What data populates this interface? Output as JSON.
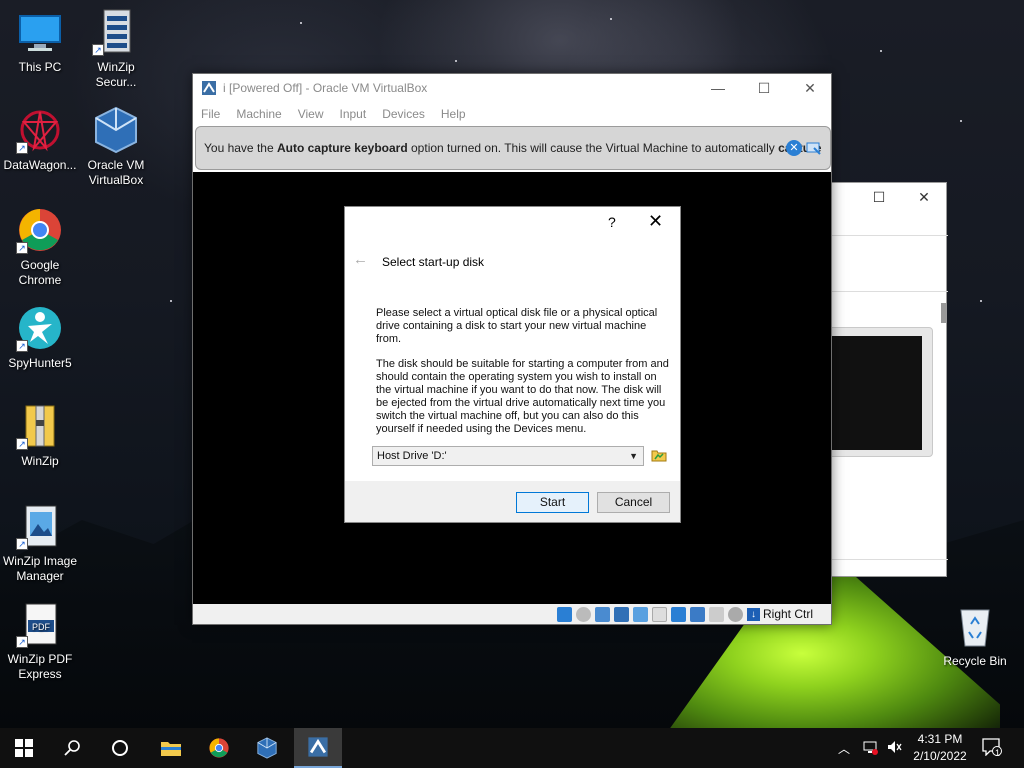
{
  "desktop": {
    "icons": [
      {
        "label": "This PC",
        "icon": "monitor-icon"
      },
      {
        "label": "WinZip Secur...",
        "icon": "winzip-secure-icon"
      },
      {
        "label": "DataWagon...",
        "icon": "datawagon-icon"
      },
      {
        "label": "Oracle VM VirtualBox",
        "icon": "virtualbox-icon"
      },
      {
        "label": "Google Chrome",
        "icon": "chrome-icon"
      },
      {
        "label": "SpyHunter5",
        "icon": "spyhunter-icon"
      },
      {
        "label": "WinZip",
        "icon": "winzip-icon"
      },
      {
        "label": "WinZip Image Manager",
        "icon": "winzip-image-icon"
      },
      {
        "label": "WinZip PDF Express",
        "icon": "winzip-pdf-icon"
      },
      {
        "label": "Recycle Bin",
        "icon": "recycle-bin-icon"
      }
    ]
  },
  "vbox": {
    "title": "i [Powered Off] - Oracle VM VirtualBox",
    "menu": [
      "File",
      "Machine",
      "View",
      "Input",
      "Devices",
      "Help"
    ],
    "notice": {
      "pre": "You have the ",
      "bold1": "Auto capture keyboard",
      "mid": " option turned on. This will cause the Virtual Machine to automatically ",
      "bold2": "capture"
    },
    "status": {
      "host_key": "Right Ctrl"
    }
  },
  "dialog": {
    "help": "?",
    "close": "✕",
    "heading": "Select start-up disk",
    "para1": "Please select a virtual optical disk file or a physical optical drive containing a disk to start your new virtual machine from.",
    "para2": "The disk should be suitable for starting a computer from and should contain the operating system you wish to install on the virtual machine if you want to do that now. The disk will be ejected from the virtual drive automatically next time you switch the virtual machine off, but you can also do this yourself if needed using the Devices menu.",
    "selected_drive": "Host Drive 'D:'",
    "start_label": "Start",
    "cancel_label": "Cancel"
  },
  "taskbar": {
    "time": "4:31 PM",
    "date": "2/10/2022",
    "notification_count": "1"
  },
  "colors": {
    "accent": "#0078d7",
    "taskbar": "#101010",
    "notice_bg": "#d6d6d6"
  }
}
